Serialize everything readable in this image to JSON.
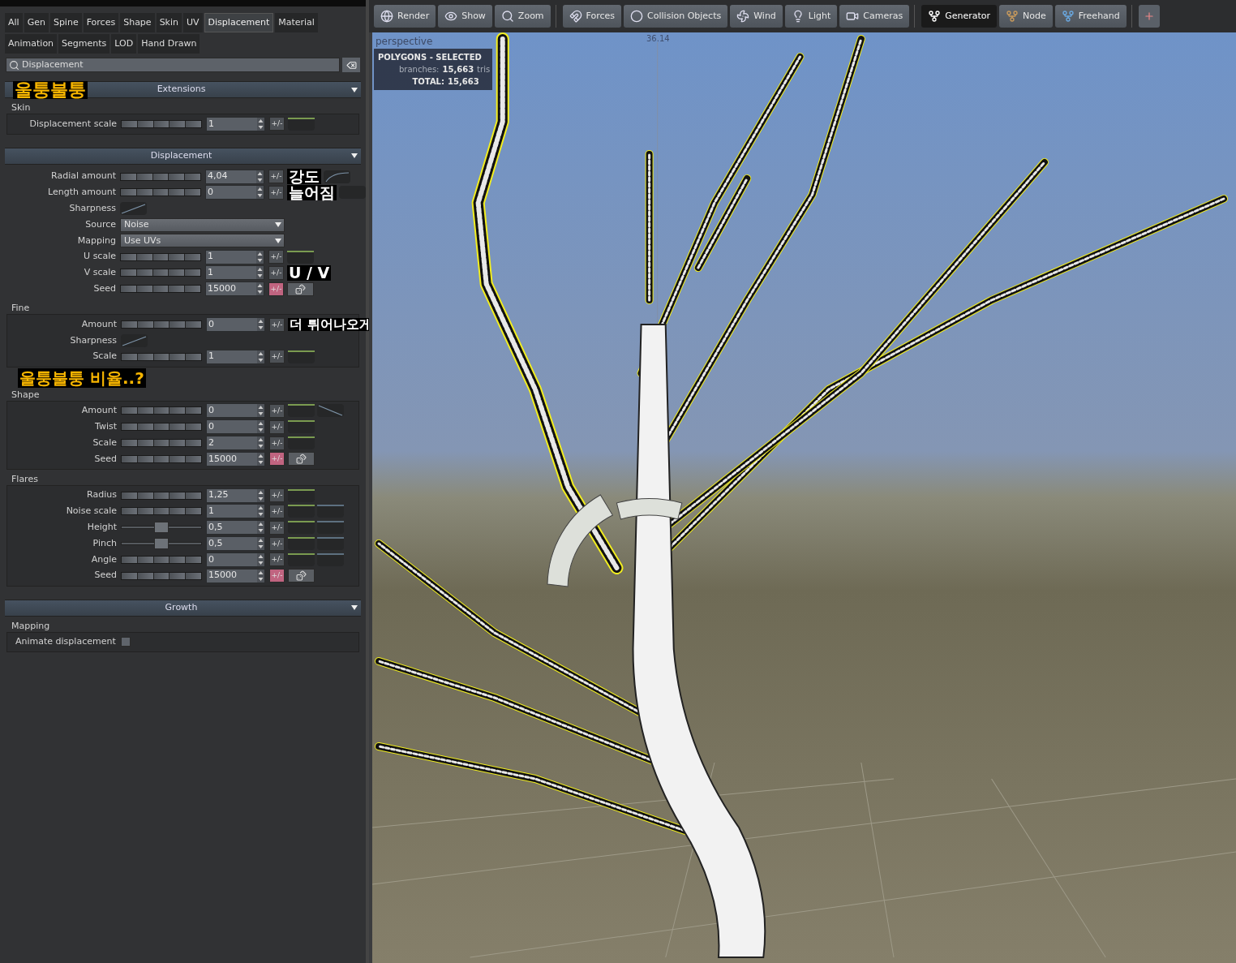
{
  "tabs": [
    {
      "label": "All",
      "selected": false
    },
    {
      "label": "Gen",
      "selected": false
    },
    {
      "label": "Spine",
      "selected": false
    },
    {
      "label": "Forces",
      "selected": false
    },
    {
      "label": "Shape",
      "selected": false
    },
    {
      "label": "Skin",
      "selected": false
    },
    {
      "label": "UV",
      "selected": false
    },
    {
      "label": "Displacement",
      "selected": true
    },
    {
      "label": "Material",
      "selected": false
    },
    {
      "label": "Animation",
      "selected": false
    },
    {
      "label": "Segments",
      "selected": false
    },
    {
      "label": "LOD",
      "selected": false
    },
    {
      "label": "Hand Drawn",
      "selected": false
    }
  ],
  "search": {
    "value": "Displacement"
  },
  "sections": [
    {
      "title": "Extensions",
      "note": {
        "text": "울퉁불퉁",
        "kind": "yellow"
      },
      "expanded": true,
      "groups": [
        {
          "title": "Skin",
          "rows": [
            {
              "kind": "slider",
              "label": "Displacement scale",
              "value": "1",
              "pm": "+/-",
              "random": false,
              "extras": [
                {
                  "kind": "green"
                }
              ]
            }
          ]
        }
      ]
    },
    {
      "title": "Displacement",
      "expanded": true,
      "groups": [
        {
          "rows": [
            {
              "kind": "slider",
              "label": "Radial amount",
              "value": "4,04",
              "pm": "+/-",
              "random": false,
              "note": {
                "text": "강도",
                "kind": "white"
              },
              "extras": [
                {
                  "kind": "rise"
                }
              ]
            },
            {
              "kind": "slider",
              "label": "Length amount",
              "value": "0",
              "pm": "+/-",
              "random": false,
              "note": {
                "text": "늘어짐",
                "kind": "white"
              },
              "extras": [
                {
                  "kind": "plain"
                }
              ]
            },
            {
              "kind": "curve",
              "label": "Sharpness"
            },
            {
              "kind": "dropdown",
              "label": "Source",
              "value": "Noise"
            },
            {
              "kind": "dropdown",
              "label": "Mapping",
              "value": "Use UVs"
            },
            {
              "kind": "slider",
              "label": "U scale",
              "value": "1",
              "pm": "+/-",
              "random": false,
              "extras": [
                {
                  "kind": "green"
                }
              ]
            },
            {
              "kind": "slider",
              "label": "V scale",
              "value": "1",
              "pm": "+/-",
              "random": false,
              "note": {
                "text": "U / V",
                "kind": "white"
              },
              "extras": []
            },
            {
              "kind": "slider",
              "label": "Seed",
              "value": "15000",
              "pm": "+/-",
              "random": true,
              "extras": [
                {
                  "kind": "dice"
                }
              ]
            }
          ]
        },
        {
          "title": "Fine",
          "note": {
            "text": "울퉁불퉁 비율..?",
            "kind": "yellow"
          },
          "rows": [
            {
              "kind": "slider",
              "label": "Amount",
              "value": "0",
              "pm": "+/-",
              "random": false,
              "note": {
                "text": "더 튀어나오게",
                "kind": "white"
              },
              "extras": []
            },
            {
              "kind": "curve",
              "label": "Sharpness"
            },
            {
              "kind": "slider",
              "label": "Scale",
              "value": "1",
              "pm": "+/-",
              "random": false,
              "extras": [
                {
                  "kind": "green"
                }
              ]
            }
          ]
        },
        {
          "title": "Shape",
          "rows": [
            {
              "kind": "slider",
              "label": "Amount",
              "value": "0",
              "pm": "+/-",
              "random": false,
              "extras": [
                {
                  "kind": "green"
                },
                {
                  "kind": "fall"
                }
              ]
            },
            {
              "kind": "slider",
              "label": "Twist",
              "value": "0",
              "pm": "+/-",
              "random": false,
              "extras": [
                {
                  "kind": "green"
                }
              ]
            },
            {
              "kind": "slider",
              "label": "Scale",
              "value": "2",
              "pm": "+/-",
              "random": false,
              "extras": [
                {
                  "kind": "green"
                }
              ]
            },
            {
              "kind": "slider",
              "label": "Seed",
              "value": "15000",
              "pm": "+/-",
              "random": true,
              "extras": [
                {
                  "kind": "dice"
                }
              ]
            }
          ]
        },
        {
          "title": "Flares",
          "rows": [
            {
              "kind": "slider",
              "label": "Radius",
              "value": "1,25",
              "pm": "+/-",
              "random": false,
              "extras": [
                {
                  "kind": "green"
                }
              ]
            },
            {
              "kind": "slider",
              "label": "Noise scale",
              "value": "1",
              "pm": "+/-",
              "random": false,
              "extras": [
                {
                  "kind": "green"
                },
                {
                  "kind": "blue"
                }
              ]
            },
            {
              "kind": "handle",
              "label": "Height",
              "value": "0,5",
              "level": 0.5,
              "pm": "+/-",
              "random": false,
              "extras": [
                {
                  "kind": "green"
                },
                {
                  "kind": "blue"
                }
              ]
            },
            {
              "kind": "handle",
              "label": "Pinch",
              "value": "0,5",
              "level": 0.5,
              "pm": "+/-",
              "random": false,
              "extras": [
                {
                  "kind": "green"
                },
                {
                  "kind": "blue"
                }
              ]
            },
            {
              "kind": "slider",
              "label": "Angle",
              "value": "0",
              "pm": "+/-",
              "random": false,
              "extras": [
                {
                  "kind": "green"
                },
                {
                  "kind": "blue"
                }
              ]
            },
            {
              "kind": "slider",
              "label": "Seed",
              "value": "15000",
              "pm": "+/-",
              "random": true,
              "extras": [
                {
                  "kind": "dice"
                }
              ]
            }
          ]
        }
      ]
    },
    {
      "title": "Growth",
      "expanded": true,
      "groups": [
        {
          "title": "Mapping",
          "rows": [
            {
              "kind": "checkbox",
              "label": "Animate displacement",
              "checked": false
            }
          ]
        }
      ]
    }
  ],
  "toolbar": [
    [
      {
        "label": "Render",
        "selected": false
      },
      {
        "label": "Show",
        "selected": false
      },
      {
        "label": "Zoom",
        "selected": false
      }
    ],
    [
      {
        "label": "Forces",
        "selected": false
      },
      {
        "label": "Collision Objects",
        "selected": false
      },
      {
        "label": "Wind",
        "selected": false
      },
      {
        "label": "Light",
        "selected": false
      },
      {
        "label": "Cameras",
        "selected": false
      }
    ],
    [
      {
        "label": "Generator",
        "selected": true
      },
      {
        "label": "Node",
        "selected": false
      },
      {
        "label": "Freehand",
        "selected": false
      }
    ]
  ],
  "viewport": {
    "view": "perspective",
    "ruler": "36.14",
    "stats": {
      "title": "POLYGONS - SELECTED",
      "rows": [
        {
          "label": "branches:",
          "value": "15,663",
          "unit": "tris"
        },
        {
          "label": "TOTAL:",
          "value": "15,663"
        }
      ]
    }
  }
}
